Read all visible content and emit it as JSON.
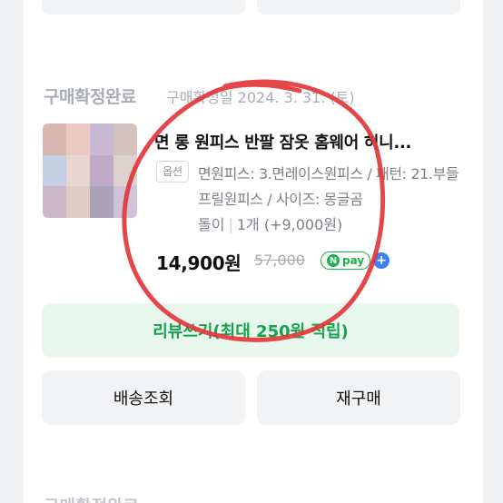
{
  "order": {
    "status": "구매확정완료",
    "date": "구매확정일 2024. 3. 31. (토)"
  },
  "product": {
    "title": "면 롱 원피스 반팔 잠옷 홈웨어 허니...",
    "option_badge": "옵션",
    "option_text": "면원피스: 3.면레이스원피스 / 패턴: 21.부들프릴원피스 / 사이즈: 몽글곰",
    "option_last": "돌이",
    "quantity": "1개 (+9,000원)",
    "price": "14,900원",
    "original_price": "57,000",
    "pay_badge": "pay",
    "pay_n": "N",
    "pay_plus": "+"
  },
  "buttons": {
    "review": "리뷰쓰기(최대 250원 적립)",
    "shipping": "배송조회",
    "rebuy": "재구매"
  },
  "next_order": {
    "status": "구매확정완료"
  },
  "colors": {
    "accent_green": "#15a24a",
    "review_bg": "#e8f7ed",
    "annotation_red": "#e2373a"
  }
}
